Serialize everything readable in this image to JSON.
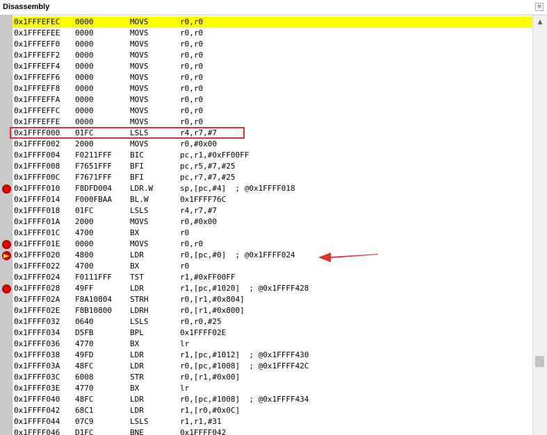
{
  "window": {
    "title": "Disassembly",
    "close_glyph": "×",
    "scroll_up_glyph": "▲"
  },
  "colors": {
    "current_line": "#ffff00",
    "breakpoint": "#e00000",
    "annotation": "#e03030"
  },
  "icons": {
    "breakpoint": "breakpoint-icon",
    "current_pc": "current-pc-arrow-icon",
    "close": "close-icon"
  },
  "rows": [
    {
      "addr": "0x1FFFEFEC",
      "code": "0000",
      "mnem": "MOVS",
      "ops": "r0,r0",
      "current": true
    },
    {
      "addr": "0x1FFFEFEE",
      "code": "0000",
      "mnem": "MOVS",
      "ops": "r0,r0"
    },
    {
      "addr": "0x1FFFEFF0",
      "code": "0000",
      "mnem": "MOVS",
      "ops": "r0,r0"
    },
    {
      "addr": "0x1FFFEFF2",
      "code": "0000",
      "mnem": "MOVS",
      "ops": "r0,r0"
    },
    {
      "addr": "0x1FFFEFF4",
      "code": "0000",
      "mnem": "MOVS",
      "ops": "r0,r0"
    },
    {
      "addr": "0x1FFFEFF6",
      "code": "0000",
      "mnem": "MOVS",
      "ops": "r0,r0"
    },
    {
      "addr": "0x1FFFEFF8",
      "code": "0000",
      "mnem": "MOVS",
      "ops": "r0,r0"
    },
    {
      "addr": "0x1FFFEFFA",
      "code": "0000",
      "mnem": "MOVS",
      "ops": "r0,r0"
    },
    {
      "addr": "0x1FFFEFFC",
      "code": "0000",
      "mnem": "MOVS",
      "ops": "r0,r0"
    },
    {
      "addr": "0x1FFFEFFE",
      "code": "0000",
      "mnem": "MOVS",
      "ops": "r0,r0"
    },
    {
      "addr": "0x1FFFF000",
      "code": "01FC",
      "mnem": "LSLS",
      "ops": "r4,r7,#7",
      "boxed": true
    },
    {
      "addr": "0x1FFFF002",
      "code": "2000",
      "mnem": "MOVS",
      "ops": "r0,#0x00"
    },
    {
      "addr": "0x1FFFF004",
      "code": "F0211FFF",
      "mnem": "BIC",
      "ops": "pc,r1,#0xFF00FF"
    },
    {
      "addr": "0x1FFFF008",
      "code": "F7651FFF",
      "mnem": "BFI",
      "ops": "pc,r5,#7,#25"
    },
    {
      "addr": "0x1FFFF00C",
      "code": "F7671FFF",
      "mnem": "BFI",
      "ops": "pc,r7,#7,#25"
    },
    {
      "addr": "0x1FFFF010",
      "code": "F8DFD004",
      "mnem": "LDR.W",
      "ops": "sp,[pc,#4]  ; @0x1FFFF018",
      "marker": "breakpoint"
    },
    {
      "addr": "0x1FFFF014",
      "code": "F000FBAA",
      "mnem": "BL.W",
      "ops": "0x1FFFF76C"
    },
    {
      "addr": "0x1FFFF018",
      "code": "01FC",
      "mnem": "LSLS",
      "ops": "r4,r7,#7"
    },
    {
      "addr": "0x1FFFF01A",
      "code": "2000",
      "mnem": "MOVS",
      "ops": "r0,#0x00"
    },
    {
      "addr": "0x1FFFF01C",
      "code": "4700",
      "mnem": "BX",
      "ops": "r0"
    },
    {
      "addr": "0x1FFFF01E",
      "code": "0000",
      "mnem": "MOVS",
      "ops": "r0,r0",
      "marker": "breakpoint"
    },
    {
      "addr": "0x1FFFF020",
      "code": "4800",
      "mnem": "LDR",
      "ops": "r0,[pc,#0]  ; @0x1FFFF024",
      "marker": "current"
    },
    {
      "addr": "0x1FFFF022",
      "code": "4700",
      "mnem": "BX",
      "ops": "r0"
    },
    {
      "addr": "0x1FFFF024",
      "code": "F0111FFF",
      "mnem": "TST",
      "ops": "r1,#0xFF00FF"
    },
    {
      "addr": "0x1FFFF028",
      "code": "49FF",
      "mnem": "LDR",
      "ops": "r1,[pc,#1020]  ; @0x1FFFF428",
      "marker": "breakpoint"
    },
    {
      "addr": "0x1FFFF02A",
      "code": "F8A10804",
      "mnem": "STRH",
      "ops": "r0,[r1,#0x804]"
    },
    {
      "addr": "0x1FFFF02E",
      "code": "F8B10800",
      "mnem": "LDRH",
      "ops": "r0,[r1,#0x800]"
    },
    {
      "addr": "0x1FFFF032",
      "code": "0640",
      "mnem": "LSLS",
      "ops": "r0,r0,#25"
    },
    {
      "addr": "0x1FFFF034",
      "code": "D5FB",
      "mnem": "BPL",
      "ops": "0x1FFFF02E"
    },
    {
      "addr": "0x1FFFF036",
      "code": "4770",
      "mnem": "BX",
      "ops": "lr"
    },
    {
      "addr": "0x1FFFF038",
      "code": "49FD",
      "mnem": "LDR",
      "ops": "r1,[pc,#1012]  ; @0x1FFFF430"
    },
    {
      "addr": "0x1FFFF03A",
      "code": "48FC",
      "mnem": "LDR",
      "ops": "r0,[pc,#1008]  ; @0x1FFFF42C"
    },
    {
      "addr": "0x1FFFF03C",
      "code": "6008",
      "mnem": "STR",
      "ops": "r0,[r1,#0x00]"
    },
    {
      "addr": "0x1FFFF03E",
      "code": "4770",
      "mnem": "BX",
      "ops": "lr"
    },
    {
      "addr": "0x1FFFF040",
      "code": "48FC",
      "mnem": "LDR",
      "ops": "r0,[pc,#1008]  ; @0x1FFFF434"
    },
    {
      "addr": "0x1FFFF042",
      "code": "68C1",
      "mnem": "LDR",
      "ops": "r1,[r0,#0x0C]"
    },
    {
      "addr": "0x1FFFF044",
      "code": "07C9",
      "mnem": "LSLS",
      "ops": "r1,r1,#31"
    },
    {
      "addr": "0x1FFFF046",
      "code": "D1FC",
      "mnem": "BNE",
      "ops": "0x1FFFF042"
    }
  ]
}
